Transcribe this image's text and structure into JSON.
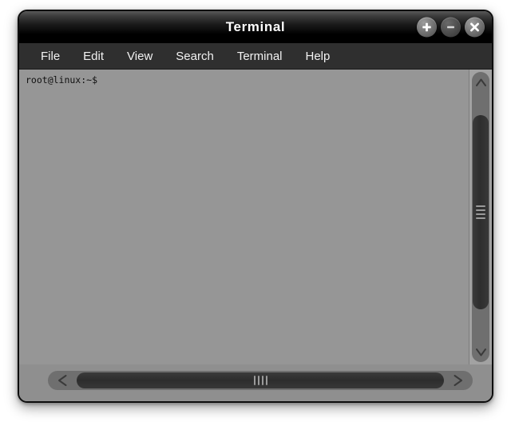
{
  "window": {
    "title": "Terminal",
    "controls": [
      {
        "name": "maximize-button",
        "icon": "plus-icon",
        "label": "+"
      },
      {
        "name": "minimize-button",
        "icon": "minus-icon",
        "label": "−"
      },
      {
        "name": "close-button",
        "icon": "close-icon",
        "label": "×"
      }
    ]
  },
  "menubar": {
    "items": [
      {
        "label": "File"
      },
      {
        "label": "Edit"
      },
      {
        "label": "View"
      },
      {
        "label": "Search"
      },
      {
        "label": "Terminal"
      },
      {
        "label": "Help"
      }
    ]
  },
  "terminal": {
    "prompt": "root@linux:~$",
    "lines": [
      "root@linux:~$"
    ],
    "background_color": "#969696",
    "text_color": "#101010"
  },
  "scrollbars": {
    "vertical": {
      "up_arrow": "∧",
      "down_arrow": "∨",
      "grip_lines": 4
    },
    "horizontal": {
      "left_arrow": "‹",
      "right_arrow": "›",
      "grip_lines": 4
    }
  },
  "colors": {
    "titlebar": "#000000",
    "menubar": "#2f2f2f",
    "window_body": "#8f8f8f",
    "terminal_bg": "#969696",
    "scroll_track": "#6f6f6f",
    "scroll_thumb": "#2e2e2e",
    "border": "#0d0d0d"
  }
}
